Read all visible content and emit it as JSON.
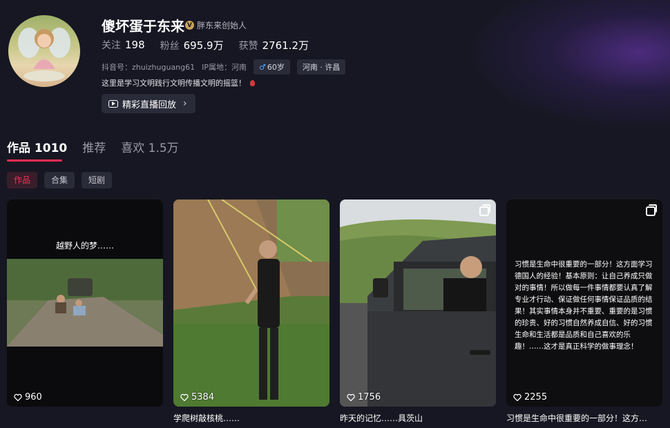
{
  "profile": {
    "name": "傻坏蛋于东来",
    "badge_icon": "v-verified-icon",
    "badge_label": "胖东来创始人",
    "following_label": "关注",
    "following_value": "198",
    "followers_label": "粉丝",
    "followers_value": "695.9万",
    "likes_label": "获赞",
    "likes_value": "2761.2万",
    "douyin_id": "抖音号：zhuizhuguang61",
    "ip_location": "IP属地：河南",
    "age_chip": "60岁",
    "region_chip": "河南 · 许昌",
    "bio": "这里是学习文明践行文明传播文明的摇篮！",
    "live_replay_label": "精彩直播回放"
  },
  "tabs": [
    {
      "label": "作品 1010",
      "active": true
    },
    {
      "label": "推荐",
      "active": false
    },
    {
      "label": "喜欢 1.5万",
      "active": false
    }
  ],
  "subtabs": [
    {
      "label": "作品",
      "active": true
    },
    {
      "label": "合集",
      "active": false
    },
    {
      "label": "短剧",
      "active": false
    }
  ],
  "videos": [
    {
      "overlay_text": "越野人的梦……",
      "likes": "960",
      "caption": ""
    },
    {
      "likes": "5384",
      "caption": "学爬树敲核桃……"
    },
    {
      "likes": "1756",
      "caption": "昨天的记忆……具茨山"
    },
    {
      "overlay_text": "习惯是生命中很重要的一部分！这方面学习德国人的经验！基本原则：让自己养成只做对的事情！所以做每一件事情都要认真了解专业才行动、保证做任何事情保证品质的结果！其实事情本身并不重要、重要的是习惯的珍贵、好的习惯自然养成自信、好的习惯生命和生活都是品质和自己喜欢的乐趣！……这才是真正科学的做事理念！",
      "likes": "2255",
      "caption": "习惯是生命中很重要的一部分！这方…"
    }
  ],
  "colors": {
    "accent": "#fe2c55",
    "background": "#161722",
    "chip": "#2a2b39"
  }
}
